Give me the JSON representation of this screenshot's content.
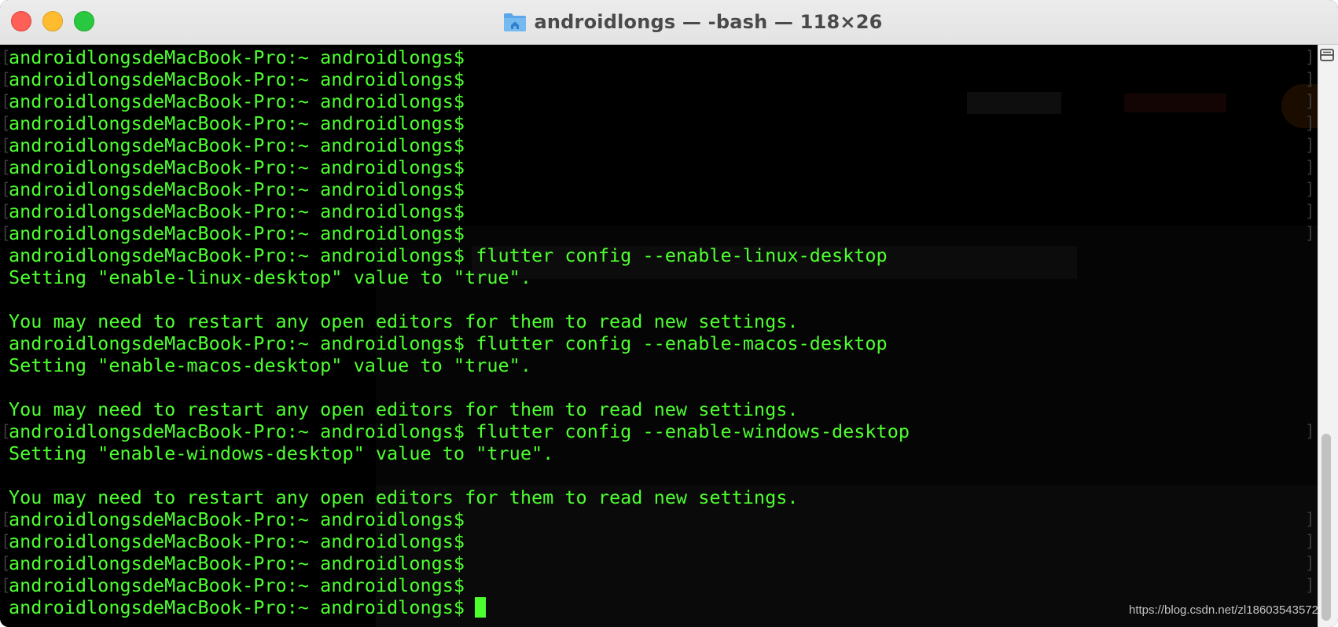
{
  "window": {
    "title": "androidlongs — -bash — 118×26",
    "buttons": {
      "close": "close",
      "minimize": "minimize",
      "zoom": "zoom"
    },
    "title_icon": "home-folder-icon"
  },
  "terminal": {
    "text_color": "#4dff2f",
    "background": "#000000",
    "lines": [
      {
        "text": "androidlongsdeMacBook-Pro:~ androidlongs$",
        "mark": true
      },
      {
        "text": "androidlongsdeMacBook-Pro:~ androidlongs$",
        "mark": true
      },
      {
        "text": "androidlongsdeMacBook-Pro:~ androidlongs$",
        "mark": true
      },
      {
        "text": "androidlongsdeMacBook-Pro:~ androidlongs$",
        "mark": true
      },
      {
        "text": "androidlongsdeMacBook-Pro:~ androidlongs$",
        "mark": true
      },
      {
        "text": "androidlongsdeMacBook-Pro:~ androidlongs$",
        "mark": true
      },
      {
        "text": "androidlongsdeMacBook-Pro:~ androidlongs$",
        "mark": true
      },
      {
        "text": "androidlongsdeMacBook-Pro:~ androidlongs$",
        "mark": true
      },
      {
        "text": "androidlongsdeMacBook-Pro:~ androidlongs$",
        "mark": true
      },
      {
        "text": "androidlongsdeMacBook-Pro:~ androidlongs$ flutter config --enable-linux-desktop",
        "mark": false
      },
      {
        "text": "Setting \"enable-linux-desktop\" value to \"true\".",
        "mark": false
      },
      {
        "text": "",
        "mark": false
      },
      {
        "text": "You may need to restart any open editors for them to read new settings.",
        "mark": false
      },
      {
        "text": "androidlongsdeMacBook-Pro:~ androidlongs$ flutter config --enable-macos-desktop",
        "mark": false
      },
      {
        "text": "Setting \"enable-macos-desktop\" value to \"true\".",
        "mark": false
      },
      {
        "text": "",
        "mark": false
      },
      {
        "text": "You may need to restart any open editors for them to read new settings.",
        "mark": false
      },
      {
        "text": "androidlongsdeMacBook-Pro:~ androidlongs$ flutter config --enable-windows-desktop",
        "mark": true
      },
      {
        "text": "Setting \"enable-windows-desktop\" value to \"true\".",
        "mark": false
      },
      {
        "text": "",
        "mark": false
      },
      {
        "text": "You may need to restart any open editors for them to read new settings.",
        "mark": false
      },
      {
        "text": "androidlongsdeMacBook-Pro:~ androidlongs$",
        "mark": true
      },
      {
        "text": "androidlongsdeMacBook-Pro:~ androidlongs$",
        "mark": true
      },
      {
        "text": "androidlongsdeMacBook-Pro:~ androidlongs$",
        "mark": true
      },
      {
        "text": "androidlongsdeMacBook-Pro:~ androidlongs$",
        "mark": true
      },
      {
        "text": "androidlongsdeMacBook-Pro:~ androidlongs$",
        "mark": false,
        "cursor": true
      }
    ],
    "bracket_left": "[",
    "bracket_right": "]"
  },
  "scrollbar": {
    "split_icon": "split-pane-icon"
  },
  "watermark": "https://blog.csdn.net/zl18603543572"
}
